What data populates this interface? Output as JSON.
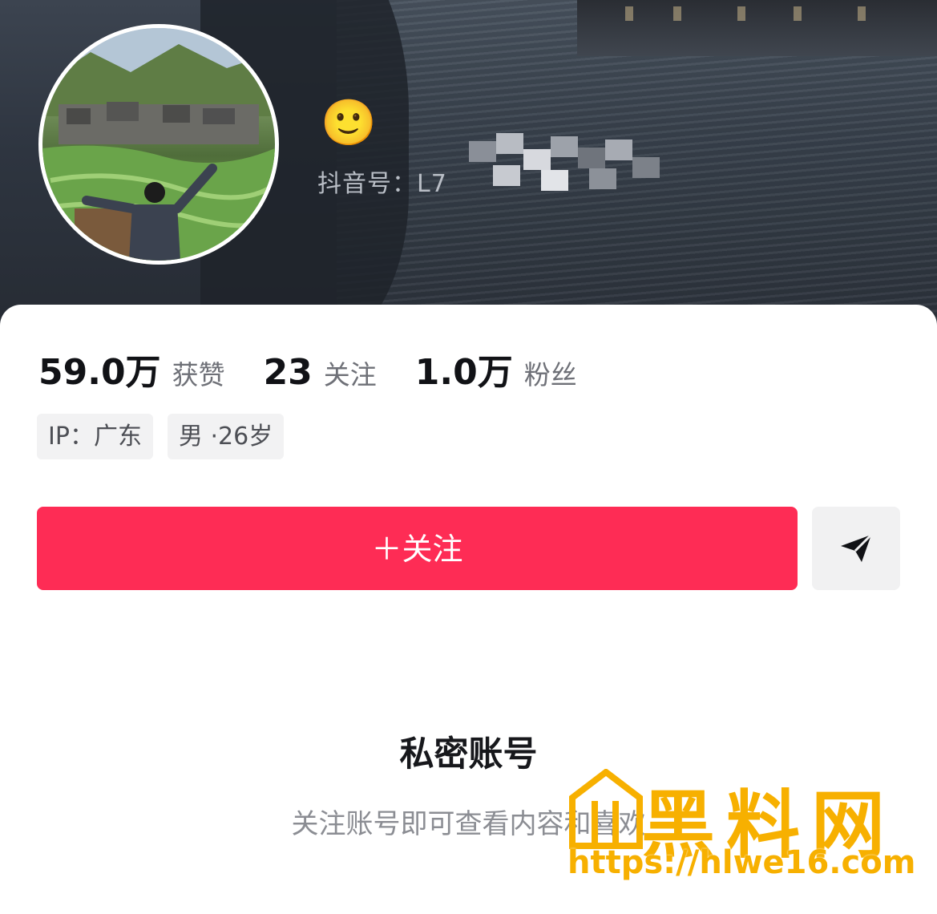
{
  "header": {
    "emoji": "🙂",
    "douyin_id": "抖音号：L7"
  },
  "stats": [
    {
      "value": "59.0万",
      "label": "获赞"
    },
    {
      "value": "23",
      "label": "关注"
    },
    {
      "value": "1.0万",
      "label": "粉丝"
    }
  ],
  "tags": [
    {
      "text": "IP：广东"
    },
    {
      "text": "男 ·26岁"
    }
  ],
  "actions": {
    "follow_label": "＋关注",
    "share_icon": "send-icon"
  },
  "private": {
    "title": "私密账号",
    "description": "关注账号即可查看内容和喜欢"
  },
  "watermark": {
    "text": "黑料网",
    "url": "https://hlwe16.com"
  },
  "colors": {
    "accent": "#fe2c55",
    "watermark": "#f7b000"
  }
}
